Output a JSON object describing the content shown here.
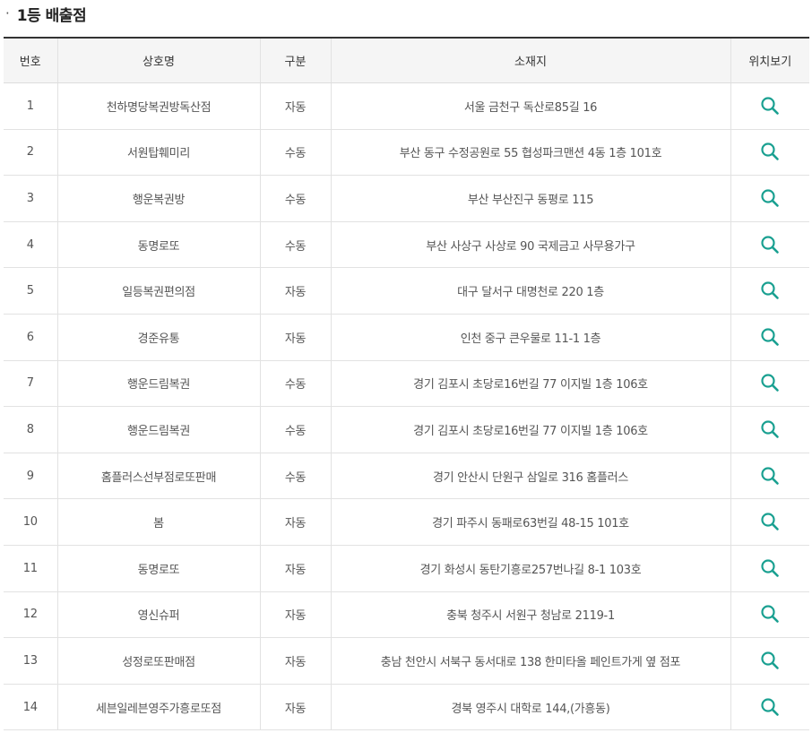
{
  "section": {
    "bullet": "·",
    "title": "1등 배출점"
  },
  "table": {
    "headers": {
      "no": "번호",
      "name": "상호명",
      "type": "구분",
      "address": "소재지",
      "map": "위치보기"
    },
    "rows": [
      {
        "no": "1",
        "name": "천하명당복권방독산점",
        "type": "자동",
        "address": "서울 금천구 독산로85길 16"
      },
      {
        "no": "2",
        "name": "서원탑훼미리",
        "type": "수동",
        "address": "부산 동구 수정공원로 55 협성파크맨션 4동 1층 101호"
      },
      {
        "no": "3",
        "name": "행운복권방",
        "type": "수동",
        "address": "부산 부산진구 동평로 115"
      },
      {
        "no": "4",
        "name": "동명로또",
        "type": "수동",
        "address": "부산 사상구 사상로 90 국제금고 사무용가구"
      },
      {
        "no": "5",
        "name": "일등복권편의점",
        "type": "자동",
        "address": "대구 달서구 대명천로 220 1층"
      },
      {
        "no": "6",
        "name": "경준유통",
        "type": "자동",
        "address": "인천 중구 큰우물로 11-1 1층"
      },
      {
        "no": "7",
        "name": "행운드림복권",
        "type": "수동",
        "address": "경기 김포시 초당로16번길 77 이지빌 1층 106호"
      },
      {
        "no": "8",
        "name": "행운드림복권",
        "type": "수동",
        "address": "경기 김포시 초당로16번길 77 이지빌 1층 106호"
      },
      {
        "no": "9",
        "name": "홈플러스선부점로또판매",
        "type": "수동",
        "address": "경기 안산시 단원구 삼일로 316 홈플러스"
      },
      {
        "no": "10",
        "name": "봄",
        "type": "자동",
        "address": "경기 파주시 동패로63번길 48-15 101호"
      },
      {
        "no": "11",
        "name": "동명로또",
        "type": "자동",
        "address": "경기 화성시 동탄기흥로257번나길 8-1 103호"
      },
      {
        "no": "12",
        "name": "영신슈퍼",
        "type": "자동",
        "address": "충북 청주시 서원구 청남로 2119-1"
      },
      {
        "no": "13",
        "name": "성정로또판매점",
        "type": "자동",
        "address": "충남 천안시 서북구 동서대로 138 한미타올 페인트가게 옆 점포"
      },
      {
        "no": "14",
        "name": "세븐일레븐영주가흥로또점",
        "type": "자동",
        "address": "경북 영주시 대학로 144,(가흥동)"
      }
    ],
    "map_icon": "search-icon"
  },
  "colors": {
    "icon_teal": "#1aa091",
    "header_bg": "#f5f5f5",
    "top_border": "#333333"
  }
}
